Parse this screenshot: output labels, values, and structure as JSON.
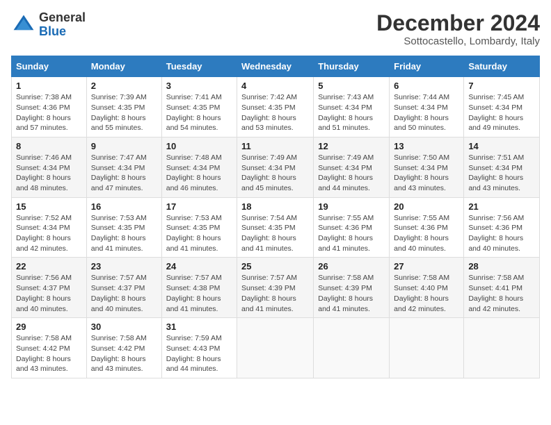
{
  "logo": {
    "general": "General",
    "blue": "Blue"
  },
  "header": {
    "month": "December 2024",
    "location": "Sottocastello, Lombardy, Italy"
  },
  "days_of_week": [
    "Sunday",
    "Monday",
    "Tuesday",
    "Wednesday",
    "Thursday",
    "Friday",
    "Saturday"
  ],
  "weeks": [
    [
      {
        "num": "1",
        "info": "Sunrise: 7:38 AM\nSunset: 4:36 PM\nDaylight: 8 hours\nand 57 minutes."
      },
      {
        "num": "2",
        "info": "Sunrise: 7:39 AM\nSunset: 4:35 PM\nDaylight: 8 hours\nand 55 minutes."
      },
      {
        "num": "3",
        "info": "Sunrise: 7:41 AM\nSunset: 4:35 PM\nDaylight: 8 hours\nand 54 minutes."
      },
      {
        "num": "4",
        "info": "Sunrise: 7:42 AM\nSunset: 4:35 PM\nDaylight: 8 hours\nand 53 minutes."
      },
      {
        "num": "5",
        "info": "Sunrise: 7:43 AM\nSunset: 4:34 PM\nDaylight: 8 hours\nand 51 minutes."
      },
      {
        "num": "6",
        "info": "Sunrise: 7:44 AM\nSunset: 4:34 PM\nDaylight: 8 hours\nand 50 minutes."
      },
      {
        "num": "7",
        "info": "Sunrise: 7:45 AM\nSunset: 4:34 PM\nDaylight: 8 hours\nand 49 minutes."
      }
    ],
    [
      {
        "num": "8",
        "info": "Sunrise: 7:46 AM\nSunset: 4:34 PM\nDaylight: 8 hours\nand 48 minutes."
      },
      {
        "num": "9",
        "info": "Sunrise: 7:47 AM\nSunset: 4:34 PM\nDaylight: 8 hours\nand 47 minutes."
      },
      {
        "num": "10",
        "info": "Sunrise: 7:48 AM\nSunset: 4:34 PM\nDaylight: 8 hours\nand 46 minutes."
      },
      {
        "num": "11",
        "info": "Sunrise: 7:49 AM\nSunset: 4:34 PM\nDaylight: 8 hours\nand 45 minutes."
      },
      {
        "num": "12",
        "info": "Sunrise: 7:49 AM\nSunset: 4:34 PM\nDaylight: 8 hours\nand 44 minutes."
      },
      {
        "num": "13",
        "info": "Sunrise: 7:50 AM\nSunset: 4:34 PM\nDaylight: 8 hours\nand 43 minutes."
      },
      {
        "num": "14",
        "info": "Sunrise: 7:51 AM\nSunset: 4:34 PM\nDaylight: 8 hours\nand 43 minutes."
      }
    ],
    [
      {
        "num": "15",
        "info": "Sunrise: 7:52 AM\nSunset: 4:34 PM\nDaylight: 8 hours\nand 42 minutes."
      },
      {
        "num": "16",
        "info": "Sunrise: 7:53 AM\nSunset: 4:35 PM\nDaylight: 8 hours\nand 41 minutes."
      },
      {
        "num": "17",
        "info": "Sunrise: 7:53 AM\nSunset: 4:35 PM\nDaylight: 8 hours\nand 41 minutes."
      },
      {
        "num": "18",
        "info": "Sunrise: 7:54 AM\nSunset: 4:35 PM\nDaylight: 8 hours\nand 41 minutes."
      },
      {
        "num": "19",
        "info": "Sunrise: 7:55 AM\nSunset: 4:36 PM\nDaylight: 8 hours\nand 41 minutes."
      },
      {
        "num": "20",
        "info": "Sunrise: 7:55 AM\nSunset: 4:36 PM\nDaylight: 8 hours\nand 40 minutes."
      },
      {
        "num": "21",
        "info": "Sunrise: 7:56 AM\nSunset: 4:36 PM\nDaylight: 8 hours\nand 40 minutes."
      }
    ],
    [
      {
        "num": "22",
        "info": "Sunrise: 7:56 AM\nSunset: 4:37 PM\nDaylight: 8 hours\nand 40 minutes."
      },
      {
        "num": "23",
        "info": "Sunrise: 7:57 AM\nSunset: 4:37 PM\nDaylight: 8 hours\nand 40 minutes."
      },
      {
        "num": "24",
        "info": "Sunrise: 7:57 AM\nSunset: 4:38 PM\nDaylight: 8 hours\nand 41 minutes."
      },
      {
        "num": "25",
        "info": "Sunrise: 7:57 AM\nSunset: 4:39 PM\nDaylight: 8 hours\nand 41 minutes."
      },
      {
        "num": "26",
        "info": "Sunrise: 7:58 AM\nSunset: 4:39 PM\nDaylight: 8 hours\nand 41 minutes."
      },
      {
        "num": "27",
        "info": "Sunrise: 7:58 AM\nSunset: 4:40 PM\nDaylight: 8 hours\nand 42 minutes."
      },
      {
        "num": "28",
        "info": "Sunrise: 7:58 AM\nSunset: 4:41 PM\nDaylight: 8 hours\nand 42 minutes."
      }
    ],
    [
      {
        "num": "29",
        "info": "Sunrise: 7:58 AM\nSunset: 4:42 PM\nDaylight: 8 hours\nand 43 minutes."
      },
      {
        "num": "30",
        "info": "Sunrise: 7:58 AM\nSunset: 4:42 PM\nDaylight: 8 hours\nand 43 minutes."
      },
      {
        "num": "31",
        "info": "Sunrise: 7:59 AM\nSunset: 4:43 PM\nDaylight: 8 hours\nand 44 minutes."
      },
      {
        "num": "",
        "info": ""
      },
      {
        "num": "",
        "info": ""
      },
      {
        "num": "",
        "info": ""
      },
      {
        "num": "",
        "info": ""
      }
    ]
  ]
}
